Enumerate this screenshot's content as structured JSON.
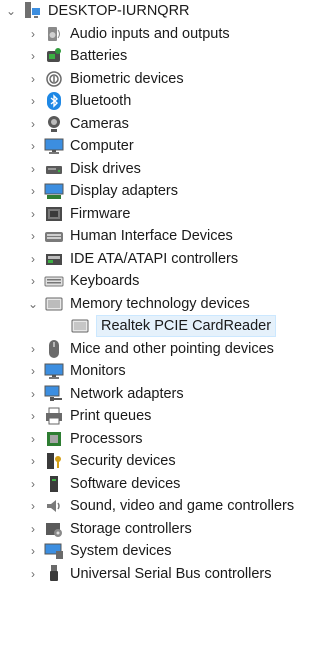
{
  "root": {
    "label": "DESKTOP-IURNQRR",
    "icon": "computer-root-icon",
    "expanded": true
  },
  "categories": [
    {
      "label": "Audio inputs and outputs",
      "icon": "speaker-icon"
    },
    {
      "label": "Batteries",
      "icon": "battery-icon"
    },
    {
      "label": "Biometric devices",
      "icon": "fingerprint-icon"
    },
    {
      "label": "Bluetooth",
      "icon": "bluetooth-icon"
    },
    {
      "label": "Cameras",
      "icon": "camera-icon"
    },
    {
      "label": "Computer",
      "icon": "monitor-icon"
    },
    {
      "label": "Disk drives",
      "icon": "disk-drive-icon"
    },
    {
      "label": "Display adapters",
      "icon": "display-adapter-icon"
    },
    {
      "label": "Firmware",
      "icon": "firmware-icon"
    },
    {
      "label": "Human Interface Devices",
      "icon": "hid-icon"
    },
    {
      "label": "IDE ATA/ATAPI controllers",
      "icon": "ide-controller-icon"
    },
    {
      "label": "Keyboards",
      "icon": "keyboard-icon"
    },
    {
      "label": "Memory technology devices",
      "icon": "memory-device-icon",
      "expanded": true,
      "children": [
        {
          "label": "Realtek PCIE CardReader",
          "icon": "card-reader-icon",
          "selected": true
        }
      ]
    },
    {
      "label": "Mice and other pointing devices",
      "icon": "mouse-icon"
    },
    {
      "label": "Monitors",
      "icon": "monitor-icon"
    },
    {
      "label": "Network adapters",
      "icon": "network-icon"
    },
    {
      "label": "Print queues",
      "icon": "printer-icon"
    },
    {
      "label": "Processors",
      "icon": "processor-icon"
    },
    {
      "label": "Security devices",
      "icon": "security-device-icon"
    },
    {
      "label": "Software devices",
      "icon": "software-device-icon"
    },
    {
      "label": "Sound, video and game controllers",
      "icon": "sound-controller-icon"
    },
    {
      "label": "Storage controllers",
      "icon": "storage-controller-icon"
    },
    {
      "label": "System devices",
      "icon": "system-devices-icon"
    },
    {
      "label": "Universal Serial Bus controllers",
      "icon": "usb-icon"
    }
  ],
  "colors": {
    "selection_bg": "#e5f1fb",
    "selection_border": "#cce8ff",
    "accent_blue": "#1e88e5"
  }
}
